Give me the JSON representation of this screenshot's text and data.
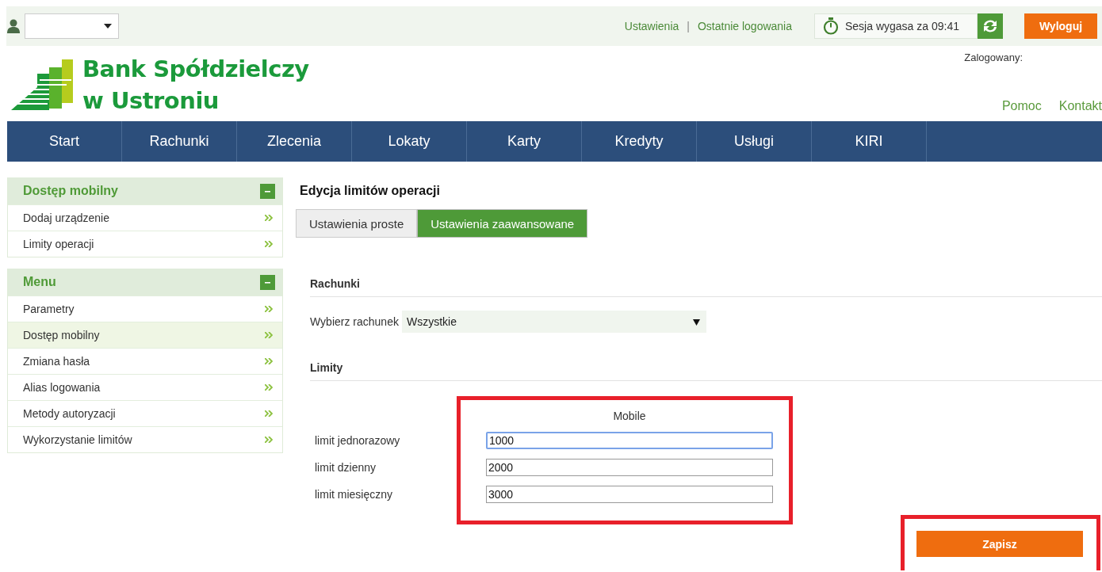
{
  "topbar": {
    "links": [
      "Ustawienia",
      "Ostatnie logowania"
    ],
    "separator": "|",
    "session": "Sesja wygasa za 09:41",
    "logout": "Wyloguj"
  },
  "header": {
    "logo": [
      "Bank Spółdzielczy",
      "w Ustroniu"
    ],
    "logged_in": "Zalogowany:",
    "links": [
      "Pomoc",
      "Kontakt"
    ]
  },
  "nav": [
    {
      "label": "Start"
    },
    {
      "label": "Rachunki"
    },
    {
      "label": "Zlecenia"
    },
    {
      "label": "Lokaty"
    },
    {
      "label": "Karty"
    },
    {
      "label": "Kredyty"
    },
    {
      "label": "Usługi"
    },
    {
      "label": "KIRI"
    }
  ],
  "sidebar": [
    {
      "title": "Dostęp mobilny",
      "expanded": true,
      "items": [
        {
          "label": "Dodaj urządzenie",
          "selected": false
        },
        {
          "label": "Limity operacji",
          "selected": false
        }
      ]
    },
    {
      "title": "Menu",
      "expanded": true,
      "items": [
        {
          "label": "Parametry",
          "selected": false
        },
        {
          "label": "Dostęp mobilny",
          "selected": true
        },
        {
          "label": "Zmiana hasła",
          "selected": false
        },
        {
          "label": "Alias logowania",
          "selected": false
        },
        {
          "label": "Metody autoryzacji",
          "selected": false
        },
        {
          "label": "Wykorzystanie limitów",
          "selected": false
        }
      ]
    }
  ],
  "page_title": "Edycja limitów operacji",
  "tabs": [
    {
      "label": "Ustawienia proste",
      "selected": false
    },
    {
      "label": "Ustawienia zaawansowane",
      "selected": true
    }
  ],
  "accounts": {
    "heading": "Rachunki",
    "label": "Wybierz rachunek",
    "value": "Wszystkie"
  },
  "limits": {
    "heading": "Limity",
    "column": "Mobile",
    "rows": [
      {
        "label": "limit jednorazowy",
        "value": "1000",
        "focused": true
      },
      {
        "label": "limit dzienny",
        "value": "2000",
        "focused": false
      },
      {
        "label": "limit miesięczny",
        "value": "3000",
        "focused": false
      }
    ]
  },
  "save": "Zapisz"
}
